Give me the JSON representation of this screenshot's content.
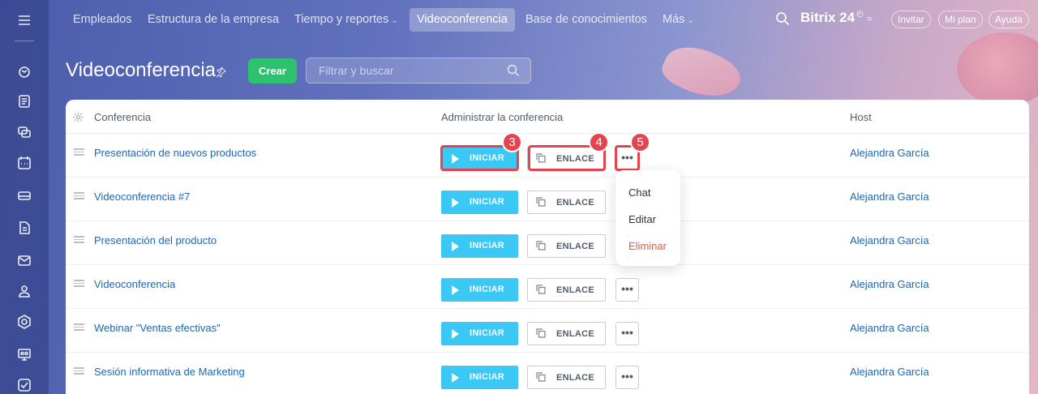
{
  "topnav": {
    "items": [
      {
        "label": "Empleados",
        "dropdown": false,
        "active": false
      },
      {
        "label": "Estructura de la empresa",
        "dropdown": false,
        "active": false
      },
      {
        "label": "Tiempo y reportes",
        "dropdown": true,
        "active": false
      },
      {
        "label": "Videoconferencia",
        "dropdown": false,
        "active": true
      },
      {
        "label": "Base de conocimientos",
        "dropdown": false,
        "active": false
      },
      {
        "label": "Más",
        "dropdown": true,
        "active": false
      }
    ],
    "brand": "Bitrix 24",
    "invite_label": "Invitar",
    "myplan_label": "Mi plan",
    "help_label": "Ayuda"
  },
  "page": {
    "title": "Videoconferencia",
    "create_label": "Crear",
    "filter_placeholder": "Filtrar y buscar"
  },
  "table": {
    "headers": {
      "conference": "Conferencia",
      "manage": "Administrar la conferencia",
      "host": "Host"
    },
    "start_label": "INICIAR",
    "link_label": "ENLACE",
    "more_label": "•••",
    "rows": [
      {
        "name": "Presentación de nuevos productos",
        "host": "Alejandra García"
      },
      {
        "name": "Videoconferencia #7",
        "host": "Alejandra García"
      },
      {
        "name": "Presentación del producto",
        "host": "Alejandra García"
      },
      {
        "name": "Videoconferencia",
        "host": "Alejandra García"
      },
      {
        "name": "Webinar \"Ventas efectivas\"",
        "host": "Alejandra García"
      },
      {
        "name": "Sesión informativa de Marketing",
        "host": "Alejandra García"
      }
    ]
  },
  "context_menu": {
    "items": [
      "Chat",
      "Editar",
      "Eliminar"
    ]
  },
  "callouts": [
    "3",
    "4",
    "5"
  ],
  "colors": {
    "start_button": "#3bc8f5",
    "create_button": "#2fc26e",
    "link_text": "#2066b0",
    "highlight": "#e5434d",
    "delete_text": "#e55a3c"
  }
}
